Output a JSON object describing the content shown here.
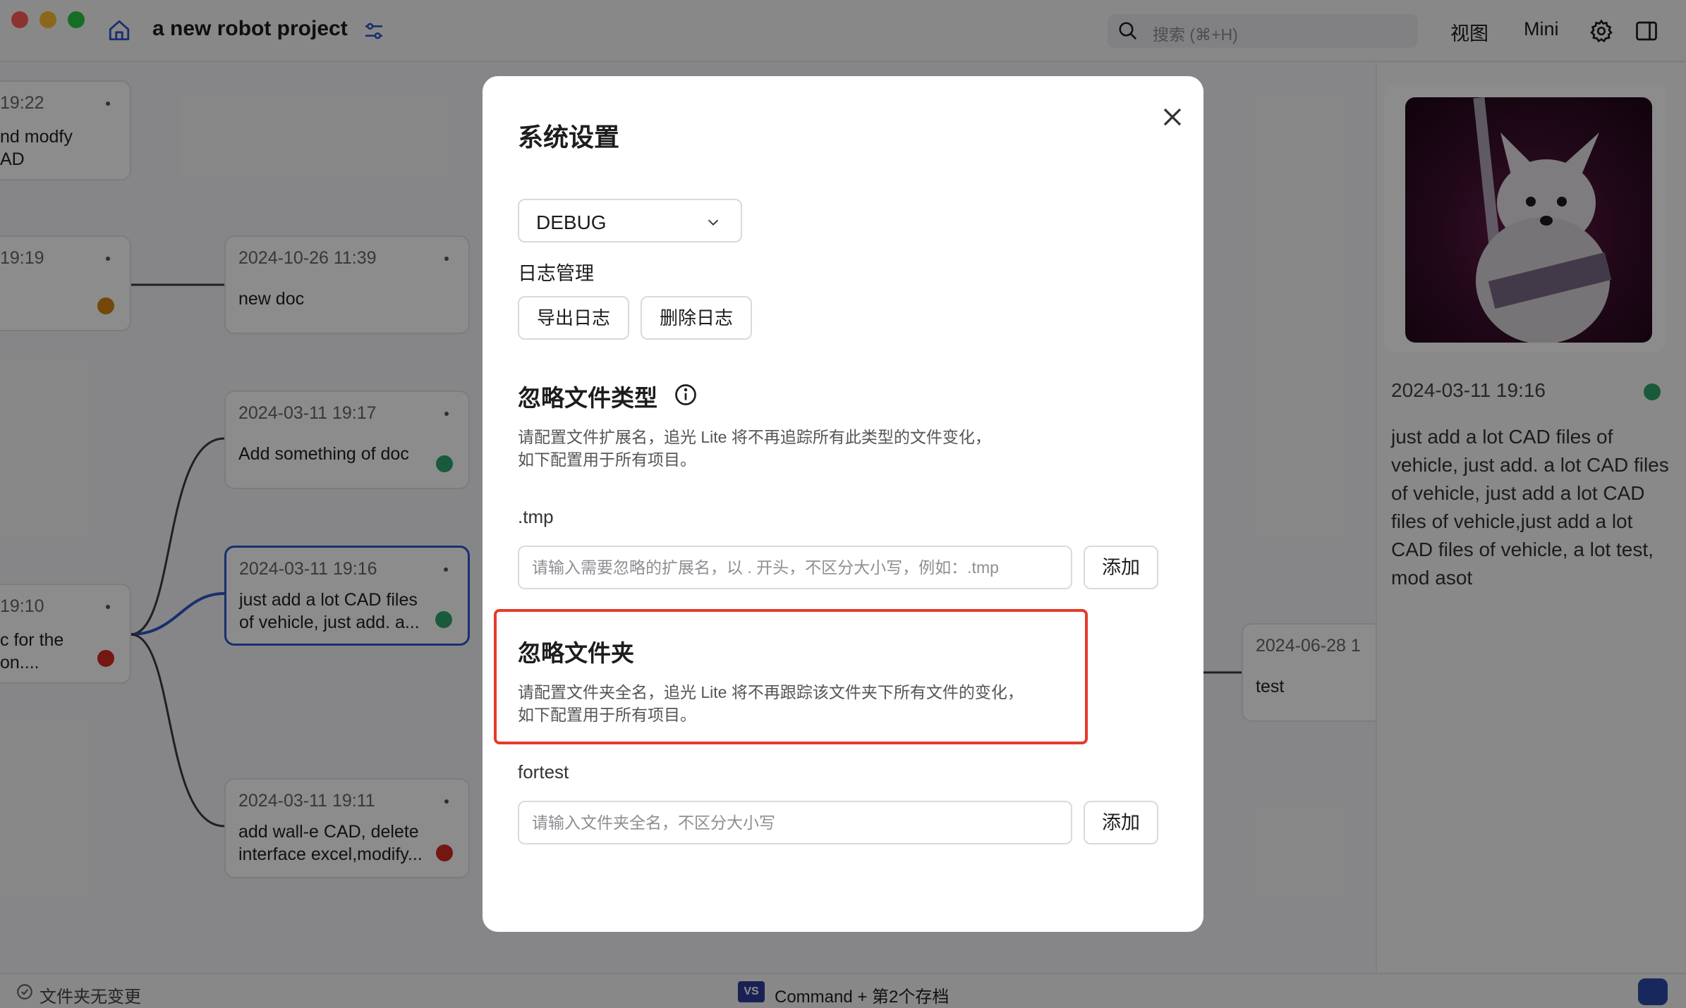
{
  "titlebar": {
    "project_title": "a new robot project",
    "search_placeholder": "搜索 (⌘+H)",
    "view_label": "视图",
    "mini_label": "Mini"
  },
  "canvas": {
    "cards": [
      {
        "time": "19:22",
        "text": "nd modfy\nAD"
      },
      {
        "time": "19:19",
        "text": "",
        "status_color": "#d4830f"
      },
      {
        "time": "2024-10-26 11:39",
        "text": "new doc"
      },
      {
        "time": "2024-03-11 19:17",
        "text": "Add something of doc",
        "status_color": "#2fa56b"
      },
      {
        "time": "2024-03-11 19:16",
        "text": "just add a lot CAD files of vehicle, just add. a...",
        "status_color": "#2fa56b"
      },
      {
        "time": "19:10",
        "text": "c for the\non....",
        "status_color": "#d62b1f"
      },
      {
        "time": "2024-03-11 19:11",
        "text": "add wall-e CAD, delete interface excel,modify...",
        "status_color": "#d62b1f"
      },
      {
        "time": "2024-06-28 1",
        "text": "test"
      }
    ]
  },
  "right_panel": {
    "time": "2024-03-11 19:16",
    "status_color": "#2fa56b",
    "description": "just add a lot CAD files of vehicle, just add. a lot CAD files of vehicle, just add a lot CAD files of vehicle,just add a lot CAD files of vehicle, a lot test, mod asot"
  },
  "statusbar": {
    "left_text": "文件夹无变更",
    "vs_badge": "VS",
    "center_text": "Command + 第2个存档"
  },
  "modal": {
    "title": "系统设置",
    "log_level": "DEBUG",
    "log_section_title": "日志管理",
    "export_log_label": "导出日志",
    "delete_log_label": "删除日志",
    "ignore_types": {
      "title": "忽略文件类型",
      "description_line1": "请配置文件扩展名，追光 Lite 将不再追踪所有此类型的文件变化，",
      "description_line2": "如下配置用于所有项目。",
      "tags": [
        ".tmp"
      ],
      "input_placeholder": "请输入需要忽略的扩展名，以 . 开头，不区分大小写，例如：.tmp",
      "add_label": "添加"
    },
    "ignore_folders": {
      "title": "忽略文件夹",
      "description_line1": "请配置文件夹全名，追光 Lite 将不再跟踪该文件夹下所有文件的变化，",
      "description_line2": "如下配置用于所有项目。",
      "tags": [
        "fortest"
      ],
      "input_placeholder": "请输入文件夹全名，不区分大小写",
      "add_label": "添加"
    }
  }
}
